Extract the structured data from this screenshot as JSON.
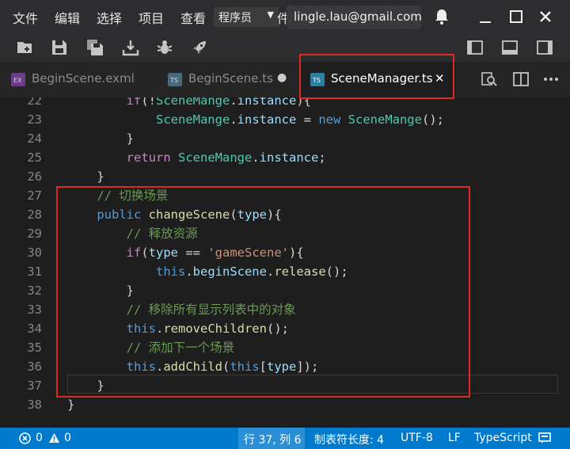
{
  "menubar": {
    "items": [
      "文件",
      "编辑",
      "选择",
      "项目",
      "查看",
      "件"
    ],
    "role_select": "程序员",
    "tooltip": "lingle.lau@gmail.com"
  },
  "tabs": [
    {
      "label": "BeginScene.exml",
      "icon": "exml-file-icon",
      "state": "inactive"
    },
    {
      "label": "BeginScene.ts",
      "icon": "ts-file-icon",
      "state": "modified"
    },
    {
      "label": "SceneManager.ts",
      "icon": "ts-file-icon",
      "state": "active"
    }
  ],
  "tab_glyphs": {
    "modified": "●",
    "close": "✕"
  },
  "editor": {
    "lines": [
      {
        "n": "22",
        "t": [
          {
            "c": "t-p",
            "s": "        "
          },
          {
            "c": "t-ctrl",
            "s": "if"
          },
          {
            "c": "t-p",
            "s": "(!"
          },
          {
            "c": "t-cls",
            "s": "SceneMange"
          },
          {
            "c": "t-p",
            "s": "."
          },
          {
            "c": "t-var",
            "s": "instance"
          },
          {
            "c": "t-p",
            "s": "){"
          }
        ]
      },
      {
        "n": "23",
        "t": [
          {
            "c": "t-p",
            "s": "            "
          },
          {
            "c": "t-cls",
            "s": "SceneMange"
          },
          {
            "c": "t-p",
            "s": "."
          },
          {
            "c": "t-var",
            "s": "instance"
          },
          {
            "c": "t-p",
            "s": " = "
          },
          {
            "c": "t-kw",
            "s": "new"
          },
          {
            "c": "t-p",
            "s": " "
          },
          {
            "c": "t-cls",
            "s": "SceneMange"
          },
          {
            "c": "t-p",
            "s": "();"
          }
        ]
      },
      {
        "n": "24",
        "t": [
          {
            "c": "t-p",
            "s": "        }"
          }
        ]
      },
      {
        "n": "25",
        "t": [
          {
            "c": "t-p",
            "s": "        "
          },
          {
            "c": "t-ctrl",
            "s": "return"
          },
          {
            "c": "t-p",
            "s": " "
          },
          {
            "c": "t-cls",
            "s": "SceneMange"
          },
          {
            "c": "t-p",
            "s": "."
          },
          {
            "c": "t-var",
            "s": "instance"
          },
          {
            "c": "t-p",
            "s": ";"
          }
        ]
      },
      {
        "n": "26",
        "t": [
          {
            "c": "t-p",
            "s": "    }"
          }
        ]
      },
      {
        "n": "27",
        "t": [
          {
            "c": "t-p",
            "s": "    "
          },
          {
            "c": "t-cm",
            "s": "// 切换场景"
          }
        ]
      },
      {
        "n": "28",
        "t": [
          {
            "c": "t-p",
            "s": "    "
          },
          {
            "c": "t-kw",
            "s": "public"
          },
          {
            "c": "t-p",
            "s": " "
          },
          {
            "c": "t-fn",
            "s": "changeScene"
          },
          {
            "c": "t-p",
            "s": "("
          },
          {
            "c": "t-var",
            "s": "type"
          },
          {
            "c": "t-p",
            "s": "){"
          }
        ]
      },
      {
        "n": "29",
        "t": [
          {
            "c": "t-p",
            "s": "        "
          },
          {
            "c": "t-cm",
            "s": "// 释放资源"
          }
        ]
      },
      {
        "n": "30",
        "t": [
          {
            "c": "t-p",
            "s": "        "
          },
          {
            "c": "t-ctrl",
            "s": "if"
          },
          {
            "c": "t-p",
            "s": "("
          },
          {
            "c": "t-var",
            "s": "type"
          },
          {
            "c": "t-p",
            "s": " == "
          },
          {
            "c": "t-str",
            "s": "'gameScene'"
          },
          {
            "c": "t-p",
            "s": "){"
          }
        ]
      },
      {
        "n": "31",
        "t": [
          {
            "c": "t-p",
            "s": "            "
          },
          {
            "c": "t-kw",
            "s": "this"
          },
          {
            "c": "t-p",
            "s": "."
          },
          {
            "c": "t-var",
            "s": "beginScene"
          },
          {
            "c": "t-p",
            "s": "."
          },
          {
            "c": "t-fn",
            "s": "release"
          },
          {
            "c": "t-p",
            "s": "();"
          }
        ]
      },
      {
        "n": "32",
        "t": [
          {
            "c": "t-p",
            "s": "        }"
          }
        ]
      },
      {
        "n": "33",
        "t": [
          {
            "c": "t-p",
            "s": "        "
          },
          {
            "c": "t-cm",
            "s": "// 移除所有显示列表中的对象"
          }
        ]
      },
      {
        "n": "34",
        "t": [
          {
            "c": "t-p",
            "s": "        "
          },
          {
            "c": "t-kw",
            "s": "this"
          },
          {
            "c": "t-p",
            "s": "."
          },
          {
            "c": "t-fn",
            "s": "removeChildren"
          },
          {
            "c": "t-p",
            "s": "();"
          }
        ]
      },
      {
        "n": "35",
        "t": [
          {
            "c": "t-p",
            "s": "        "
          },
          {
            "c": "t-cm",
            "s": "// 添加下一个场景"
          }
        ]
      },
      {
        "n": "36",
        "t": [
          {
            "c": "t-p",
            "s": "        "
          },
          {
            "c": "t-kw",
            "s": "this"
          },
          {
            "c": "t-p",
            "s": "."
          },
          {
            "c": "t-fn",
            "s": "addChild"
          },
          {
            "c": "t-p",
            "s": "("
          },
          {
            "c": "t-kw",
            "s": "this"
          },
          {
            "c": "t-p",
            "s": "["
          },
          {
            "c": "t-var",
            "s": "type"
          },
          {
            "c": "t-p",
            "s": "]);"
          }
        ]
      },
      {
        "n": "37",
        "t": [
          {
            "c": "t-p",
            "s": "    }"
          }
        ]
      },
      {
        "n": "38",
        "t": [
          {
            "c": "t-p",
            "s": "}"
          }
        ]
      }
    ]
  },
  "statusbar": {
    "errors": "0",
    "warnings": "0",
    "position": "行 37, 列 6",
    "indent": "制表符长度: 4",
    "encoding": "UTF-8",
    "eol": "LF",
    "language": "TypeScript"
  },
  "colors": {
    "accent": "#007acc",
    "highlight": "#e32626"
  }
}
